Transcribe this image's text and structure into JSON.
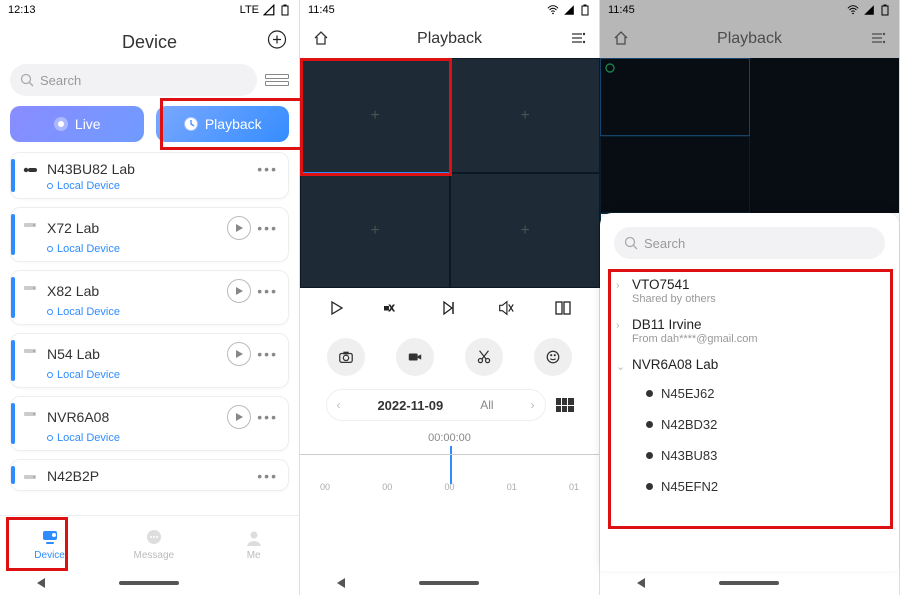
{
  "s1": {
    "time": "12:13",
    "net": "LTE",
    "title": "Device",
    "search_placeholder": "Search",
    "tab_live": "Live",
    "tab_playback": "Playback",
    "devices": [
      {
        "name": "N43BU82 Lab",
        "status": "Local Device",
        "show_play": false,
        "icon": "camera"
      },
      {
        "name": "X72 Lab",
        "status": "Local Device",
        "show_play": true,
        "icon": "nvr"
      },
      {
        "name": "X82 Lab",
        "status": "Local Device",
        "show_play": true,
        "icon": "nvr"
      },
      {
        "name": "N54 Lab",
        "status": "Local Device",
        "show_play": true,
        "icon": "nvr"
      },
      {
        "name": "NVR6A08",
        "status": "Local Device",
        "show_play": true,
        "icon": "nvr"
      },
      {
        "name": "N42B2P",
        "status": "",
        "show_play": false,
        "icon": "nvr"
      }
    ],
    "nav": {
      "device": "Device",
      "message": "Message",
      "me": "Me"
    }
  },
  "s2": {
    "time": "11:45",
    "title": "Playback",
    "date": "2022-11-09",
    "filter": "All",
    "cur_time": "00:00:00",
    "ticks": [
      "00",
      "00",
      "00",
      "01",
      "01"
    ]
  },
  "s3": {
    "time": "11:45",
    "title": "Playback",
    "search_placeholder": "Search",
    "items": [
      {
        "name": "VTO7541",
        "sub": "Shared by others",
        "type": "collapsed"
      },
      {
        "name": "DB11 Irvine",
        "sub": "From dah****@gmail.com",
        "type": "collapsed"
      },
      {
        "name": "NVR6A08 Lab",
        "sub": "",
        "type": "expanded",
        "children": [
          "N45EJ62",
          "N42BD32",
          "N43BU83",
          "N45EFN2"
        ]
      }
    ]
  }
}
